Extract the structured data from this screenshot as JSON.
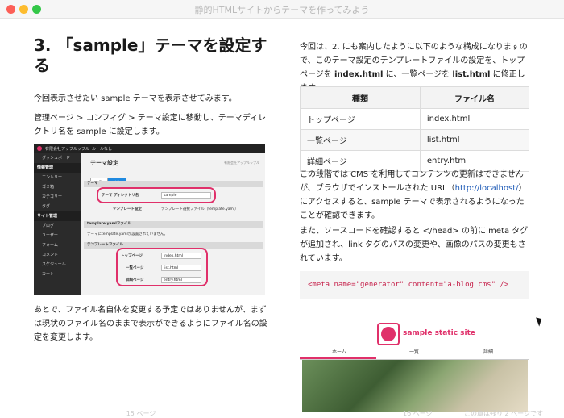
{
  "window": {
    "title": "静的HTMLサイトからテーマを作ってみよう"
  },
  "left_page": {
    "heading": "3. 「sample」テーマを設定する",
    "para1": "今回表示させたい sample テーマを表示させてみます。",
    "para2": "管理ページ > コンフィグ > テーマ設定に移動し、テーマディレクトリ名を sample に設定します。",
    "para3": "あとで、ファイル名自体を変更する予定ではありませんが、まずは現状のファイル名のままで表示ができるようにファイル名の設定を変更します。",
    "page_number": "15 ページ",
    "screenshot": {
      "site_name": "有限会社アップルップル",
      "site_menu": "ルールなし",
      "sidebar": [
        "ダッシュボード",
        "情報管理",
        "エントリー",
        "ゴミ箱",
        "カテゴリー",
        "タグ",
        "サイト管理",
        "ブログ",
        "ユーザー",
        "フォーム",
        "コメント",
        "スケジュール",
        "カート"
      ],
      "title": "テーマ設定",
      "crumb": "有限会社アップルップル",
      "tabs": [
        "一覧",
        "編集"
      ],
      "section_theme": "テーマ",
      "theme_dir_label": "テーマ ディレクトリ名",
      "theme_dir_value": "sample",
      "template_label": "テンプレート設定",
      "template_check_label": "テンプレート選択ファイル（template.yaml）",
      "section_yaml": "template.yamlファイル",
      "yaml_note": "テーマにtemplate.yamlが設置されていません。",
      "section_files": "テンプレートファイル",
      "top_label": "トップページ",
      "top_value": "index.html",
      "list_label": "一覧ページ",
      "list_value": "list.html",
      "detail_label": "詳細ページ",
      "detail_value": "entry.html"
    }
  },
  "right_page": {
    "intro_a": "今回は、2. にも案内したように以下のような構成になりますので、このテーマ設定のテンプレートファイルの設定を、トップページを ",
    "intro_b": "index.html",
    "intro_c": " に、一覧ページを ",
    "intro_d": "list.html",
    "intro_e": " に修正します。",
    "table": {
      "headers": [
        "種類",
        "ファイル名"
      ],
      "rows": [
        [
          "トップページ",
          "index.html"
        ],
        [
          "一覧ページ",
          "list.html"
        ],
        [
          "詳細ページ",
          "entry.html"
        ]
      ]
    },
    "para2_a": "この段階では CMS を利用してコンテンツの更新はできませんが、ブラウザでインストールされた URL（",
    "para2_link": "http://localhost/",
    "para2_b": "）にアクセスすると、sample テーマで表示されるようになったことが確認できます。",
    "para3": "また、ソースコードを確認すると </head> の前に meta タグが追加され、link タグのパスの変更や、画像のパスの変更もされています。",
    "code": "<meta name=\"generator\" content=\"a-blog cms\" />",
    "site": {
      "name": "sample static site",
      "nav": [
        "ホーム",
        "一覧",
        "詳細"
      ]
    },
    "page_number": "16 ページ",
    "remaining": "この章は残り 2 ページです"
  },
  "colors": {
    "accent": "#e0306a",
    "link": "#1a58b5"
  }
}
